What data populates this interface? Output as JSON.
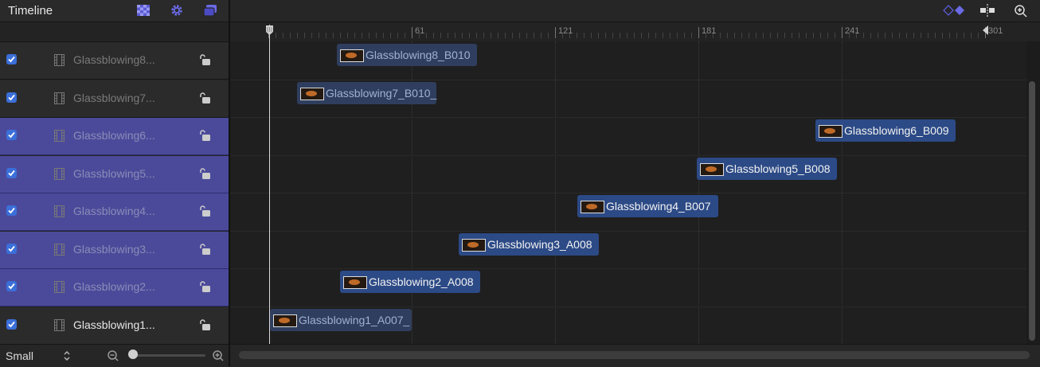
{
  "panel": {
    "title": "Timeline",
    "icons": [
      "checkerboard-icon",
      "gear-icon",
      "layers-icon"
    ]
  },
  "layers": [
    {
      "name": "Glassblowing8...",
      "checked": true,
      "selected": false
    },
    {
      "name": "Glassblowing7...",
      "checked": true,
      "selected": false
    },
    {
      "name": "Glassblowing6...",
      "checked": true,
      "selected": true
    },
    {
      "name": "Glassblowing5...",
      "checked": true,
      "selected": true
    },
    {
      "name": "Glassblowing4...",
      "checked": true,
      "selected": true
    },
    {
      "name": "Glassblowing3...",
      "checked": true,
      "selected": true
    },
    {
      "name": "Glassblowing2...",
      "checked": true,
      "selected": true
    },
    {
      "name": "Glassblowing1...",
      "checked": true,
      "selected": false
    }
  ],
  "footer": {
    "size_label": "Small",
    "zoom_level": 0.02
  },
  "ruler": {
    "labels": [
      "61",
      "121",
      "181",
      "241",
      "301"
    ]
  },
  "clips": [
    {
      "name": "Glassblowing8_B010",
      "selected": false
    },
    {
      "name": "Glassblowing7_B010_",
      "selected": false
    },
    {
      "name": "Glassblowing6_B009",
      "selected": true
    },
    {
      "name": "Glassblowing5_B008",
      "selected": true
    },
    {
      "name": "Glassblowing4_B007",
      "selected": true
    },
    {
      "name": "Glassblowing3_A008",
      "selected": true
    },
    {
      "name": "Glassblowing2_A008",
      "selected": true
    },
    {
      "name": "Glassblowing1_A007_",
      "selected": false
    }
  ],
  "toolbar_right": {
    "icons": [
      "keyframe-icon",
      "snapping-icon",
      "zoom-icon"
    ]
  },
  "colors": {
    "selection": "#4b4a9a",
    "clip_selected": "#2c4a86",
    "accent": "#5b5bd6"
  }
}
